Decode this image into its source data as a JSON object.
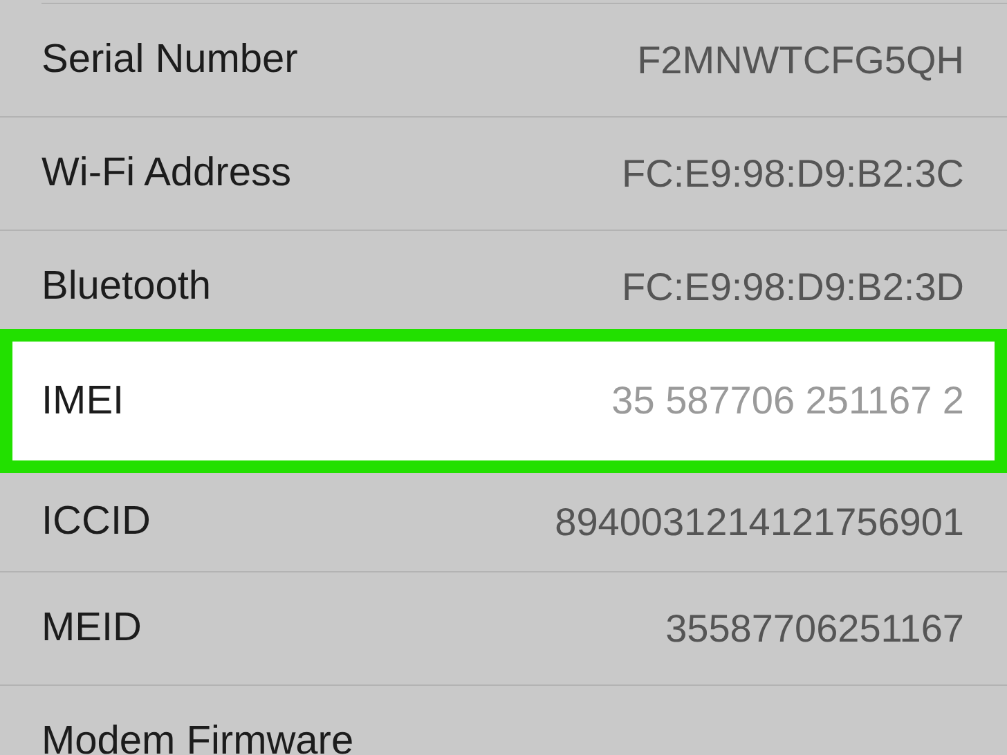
{
  "rows": [
    {
      "label": "Serial Number",
      "value": "F2MNWTCFG5QH",
      "highlighted": false
    },
    {
      "label": "Wi-Fi Address",
      "value": "FC:E9:98:D9:B2:3C",
      "highlighted": false
    },
    {
      "label": "Bluetooth",
      "value": "FC:E9:98:D9:B2:3D",
      "highlighted": false
    },
    {
      "label": "IMEI",
      "value": "35 587706 251167 2",
      "highlighted": true
    },
    {
      "label": "ICCID",
      "value": "8940031214121756901",
      "highlighted": false
    },
    {
      "label": "MEID",
      "value": "35587706251167",
      "highlighted": false
    },
    {
      "label": "Modem Firmware",
      "highlighted": false
    }
  ]
}
